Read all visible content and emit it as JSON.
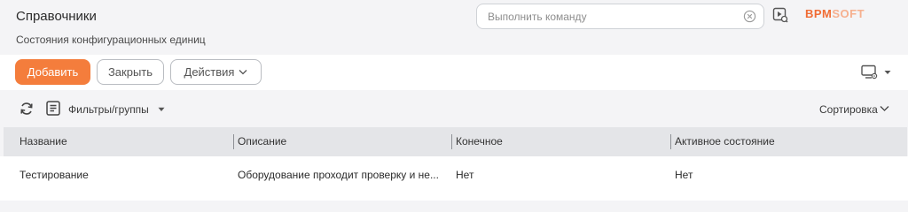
{
  "header": {
    "title": "Справочники",
    "subtitle": "Состояния конфигурационных единиц",
    "command_placeholder": "Выполнить команду",
    "logo_left": "BPM",
    "logo_right": "SOFT"
  },
  "toolbar": {
    "add_label": "Добавить",
    "close_label": "Закрыть",
    "actions_label": "Действия"
  },
  "filters": {
    "label": "Фильтры/группы",
    "sort_label": "Сортировка"
  },
  "colors": {
    "accent": "#f47d3c",
    "header_bg": "#e4e5e8",
    "page_bg": "#f4f4f6"
  },
  "grid": {
    "columns": [
      "Название",
      "Описание",
      "Конечное",
      "Активное состояние"
    ],
    "rows": [
      [
        "Тестирование",
        "Оборудование проходит проверку и не...",
        "Нет",
        "Нет"
      ]
    ]
  }
}
